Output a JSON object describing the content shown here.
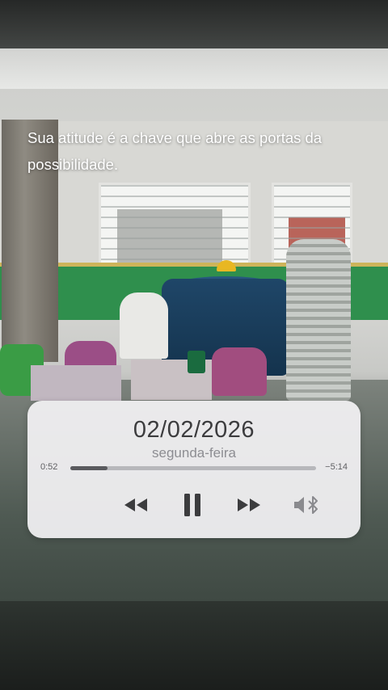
{
  "quote": {
    "line1": "Sua atitude é a chave que abre as portas da",
    "line2": "possibilidade."
  },
  "player": {
    "date": "02/02/2026",
    "weekday": "segunda-feira",
    "elapsed": "0:52",
    "remaining": "−5:14",
    "progress_fraction": 0.15,
    "controls": {
      "rewind_icon": "rewind-icon",
      "pause_icon": "pause-icon",
      "forward_icon": "fast-forward-icon",
      "output_icon": "speaker-bluetooth-icon"
    }
  },
  "colors": {
    "card_bg": "#f3f2f4",
    "text_dark": "#3c3c3e",
    "text_muted": "#8d8d92",
    "track": "#b7b7bb",
    "track_fill": "#5a5a5e"
  }
}
